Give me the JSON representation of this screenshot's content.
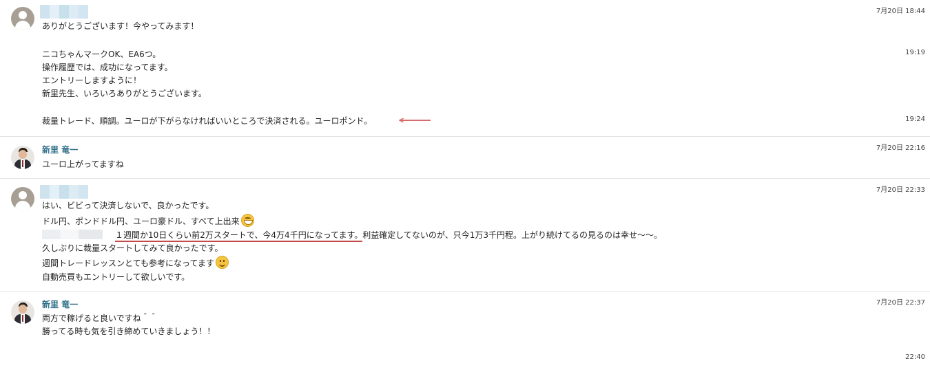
{
  "messages": [
    {
      "sender": "",
      "time": "7月20日 18:44",
      "lines": [
        "ありがとうございます！今やってみます！"
      ]
    },
    {
      "time": "19:19",
      "lines": [
        "ニコちゃんマークOK、EA6つ。",
        "操作履歴では、成功になってます。",
        "エントリーしますように！",
        "新里先生、いろいろありがとうございます。"
      ]
    },
    {
      "time": "19:24",
      "lines": [
        "裁量トレード、順調。ユーロが下がらなければいいところで決済される。ユーロポンド。"
      ]
    },
    {
      "sender": "新里 竜一",
      "time": "7月20日 22:16",
      "lines": [
        "ユーロ上がってますね"
      ]
    },
    {
      "sender": "",
      "time": "7月20日 22:33",
      "lines": [
        "はい、ビビって決済しないで、良かったです。",
        "ドル円、ポンドドル円、ユーロ豪ドル、すべて上出来",
        "１週間か10日くらい前2万スタートで、今4万4千円になってます。",
        "利益確定してないのが、只今1万3千円程。上がり続けてるの見るのは幸せ〜〜。",
        "久しぶりに裁量スタートしてみて良かったです。",
        "週間トレードレッスンとても参考になってます",
        "自動売買もエントリーして欲しいです。"
      ]
    },
    {
      "sender": "新里 竜一",
      "time": "7月20日 22:37",
      "lines": [
        "両方で稼げると良いですね＾＾",
        "勝ってる時も気を引き締めていきましょう！！"
      ]
    },
    {
      "time": "22:40",
      "lines": []
    }
  ],
  "icons": {
    "default_avatar": "user-silhouette-icon",
    "teacher_avatar": "profile-photo",
    "grin_emoji": "grin-emoji-icon",
    "smile_emoji": "smile-emoji-icon",
    "arrow": "left-arrow-annotation"
  },
  "colors": {
    "name": "#2f6f88",
    "annotation": "#c24b4b",
    "divider": "#e3e3e3"
  }
}
